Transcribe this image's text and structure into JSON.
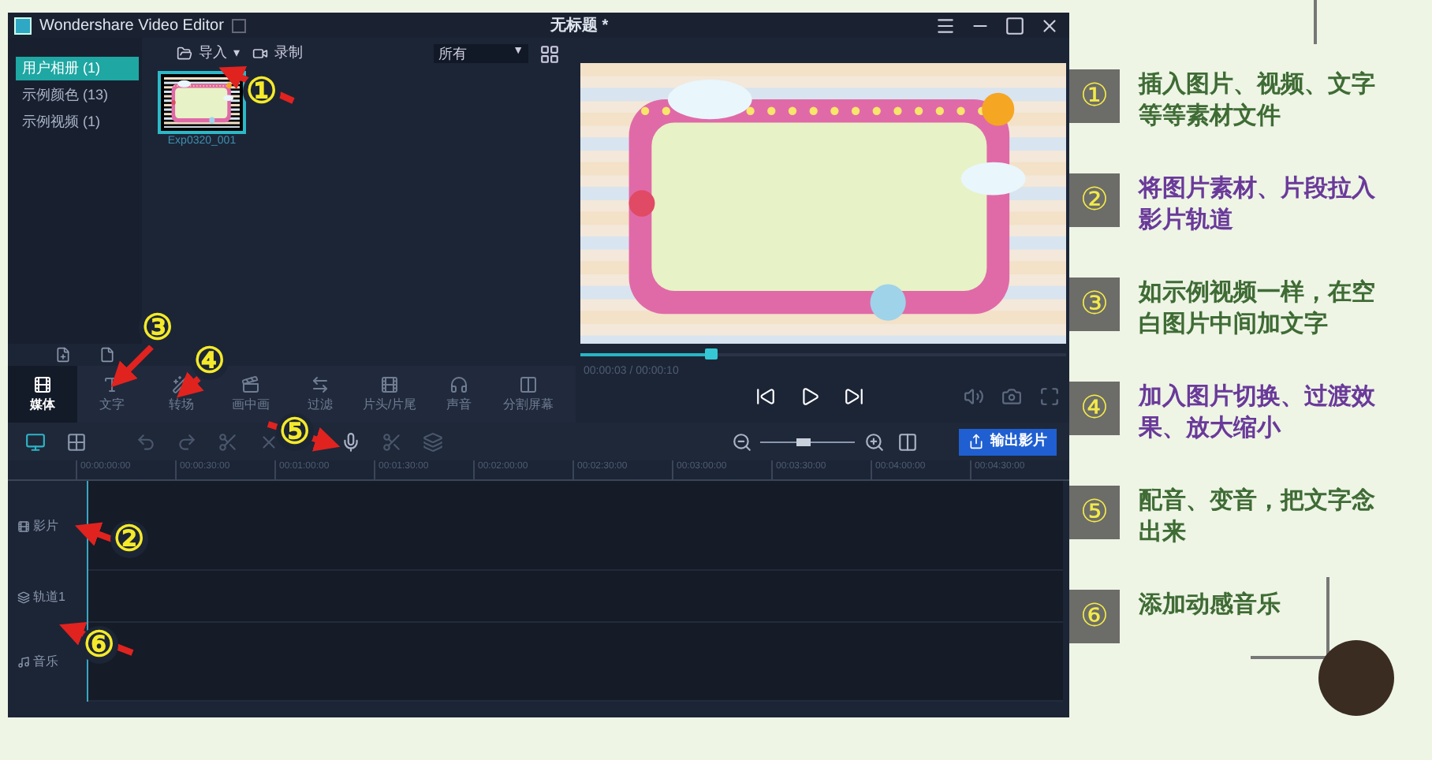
{
  "window": {
    "title": "Wondershare Video Editor",
    "document": "无标题 *"
  },
  "library": {
    "albums": [
      {
        "label": "用户相册 (1)",
        "selected": true
      },
      {
        "label": "示例颜色 (13)",
        "selected": false
      },
      {
        "label": "示例视频 (1)",
        "selected": false
      }
    ],
    "import_button": "导入",
    "import_caret": "▾",
    "record_button": "录制",
    "filter": "所有",
    "filter_caret": "▼",
    "clips": [
      {
        "name": "Exp0320_001",
        "selected": true
      }
    ]
  },
  "tools": [
    {
      "label": "媒体",
      "selected": true
    },
    {
      "label": "文字",
      "selected": false
    },
    {
      "label": "转场",
      "selected": false
    },
    {
      "label": "画中画",
      "selected": false
    },
    {
      "label": "过滤",
      "selected": false
    },
    {
      "label": "片头/片尾",
      "selected": false
    },
    {
      "label": "声音",
      "selected": false
    },
    {
      "label": "分割屏幕",
      "selected": false
    }
  ],
  "player": {
    "time": "00:00:03 / 00:00:10",
    "level": 0.27
  },
  "timeline": {
    "zoom": {
      "level": 0.45
    },
    "export_button": "输出影片",
    "ruler": [
      "00:00:00:00",
      "00:00:30:00",
      "00:01:00:00",
      "00:01:30:00",
      "00:02:00:00",
      "00:02:30:00",
      "00:03:00:00",
      "00:03:30:00",
      "00:04:00:00",
      "00:04:30:00"
    ],
    "tracks": [
      {
        "label": "影片",
        "kind": "video"
      },
      {
        "label": "轨道1",
        "kind": "overlay"
      },
      {
        "label": "音乐",
        "kind": "music"
      }
    ]
  },
  "callouts": [
    "①",
    "②",
    "③",
    "④",
    "⑤",
    "⑥"
  ],
  "notes": [
    {
      "number": "①",
      "text": "插入图片、视频、文字等等素材文件",
      "color": "#3f6b35"
    },
    {
      "number": "②",
      "text": "将图片素材、片段拉入影片轨道",
      "color": "#6a3a9a"
    },
    {
      "number": "③",
      "text": "如示例视频一样，在空白图片中间加文字",
      "color": "#3f6b35"
    },
    {
      "number": "④",
      "text": "加入图片切换、过渡效果、放大缩小",
      "color": "#6a3a9a"
    },
    {
      "number": "⑤",
      "text": "配音、变音，把文字念出来",
      "color": "#3f6b35"
    },
    {
      "number": "⑥",
      "text": "添加动感音乐",
      "color": "#3f6b35"
    }
  ]
}
